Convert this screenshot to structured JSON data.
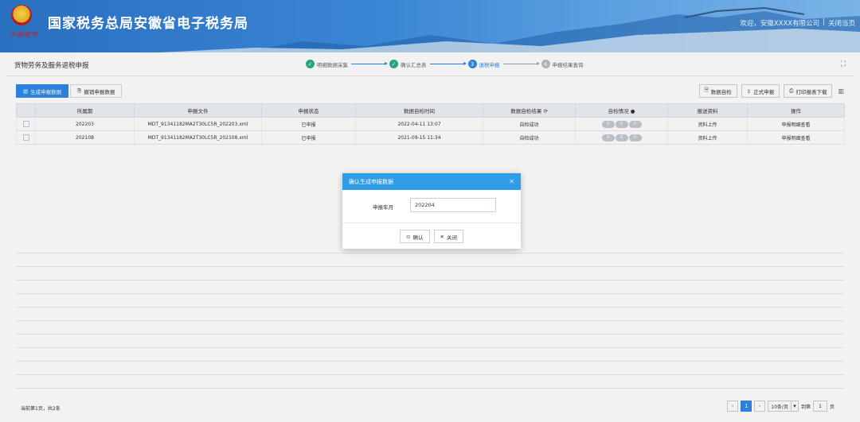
{
  "header": {
    "emblem_text": "中国税务",
    "title": "国家税务总局安徽省电子税务局",
    "user_text": "欢迎，安徽XXXX有限公司",
    "close_label": "关闭当页"
  },
  "breadcrumb": {
    "page_title": "货物劳务及服务退税申报",
    "steps": [
      {
        "num": "✓",
        "label": "明细数据采集",
        "state": "done"
      },
      {
        "num": "✓",
        "label": "确认汇总表",
        "state": "done"
      },
      {
        "num": "3",
        "label": "退税申报",
        "state": "current"
      },
      {
        "num": "4",
        "label": "申报结果查询",
        "state": "todo"
      }
    ]
  },
  "tabs": [
    {
      "label": "生成申报数据",
      "active": true
    },
    {
      "label": "撤销申报数据",
      "active": false
    }
  ],
  "toolbar": {
    "check_label": "数据自检",
    "submit_label": "正式申报",
    "print_label": "打印报表下载"
  },
  "table": {
    "headers": [
      "所属期",
      "申报文件",
      "申报状态",
      "数据自检时间",
      "数据自检结果",
      "自检情况",
      "报送资料",
      "操作"
    ],
    "rows": [
      {
        "period": "202203",
        "file": "MDT_91341182MA2T30LC5R_202203.xml",
        "status": "已申报",
        "check_time": "2022-04-11 13:07",
        "check_result": "自检成功",
        "pills": [
          "0",
          "0",
          "0"
        ],
        "upload": "资料上传",
        "action": "申报明细查看"
      },
      {
        "period": "202108",
        "file": "MDT_91341182MA2T30LC5R_202108.xml",
        "status": "已申报",
        "check_time": "2021-09-15 11:34",
        "check_result": "自检成功",
        "pills": [
          "0",
          "0",
          "0"
        ],
        "upload": "资料上传",
        "action": "申报明细查看"
      }
    ]
  },
  "footer": {
    "info": "当前第1页，共2条",
    "current_page": "1",
    "page_size": "10条/页",
    "goto_label": "到第",
    "goto_value": "1",
    "page_unit": "页"
  },
  "dialog": {
    "title": "确认生成申报数据",
    "field_label": "申报年月",
    "field_value": "202204",
    "confirm_label": "确认",
    "cancel_label": "关闭"
  }
}
